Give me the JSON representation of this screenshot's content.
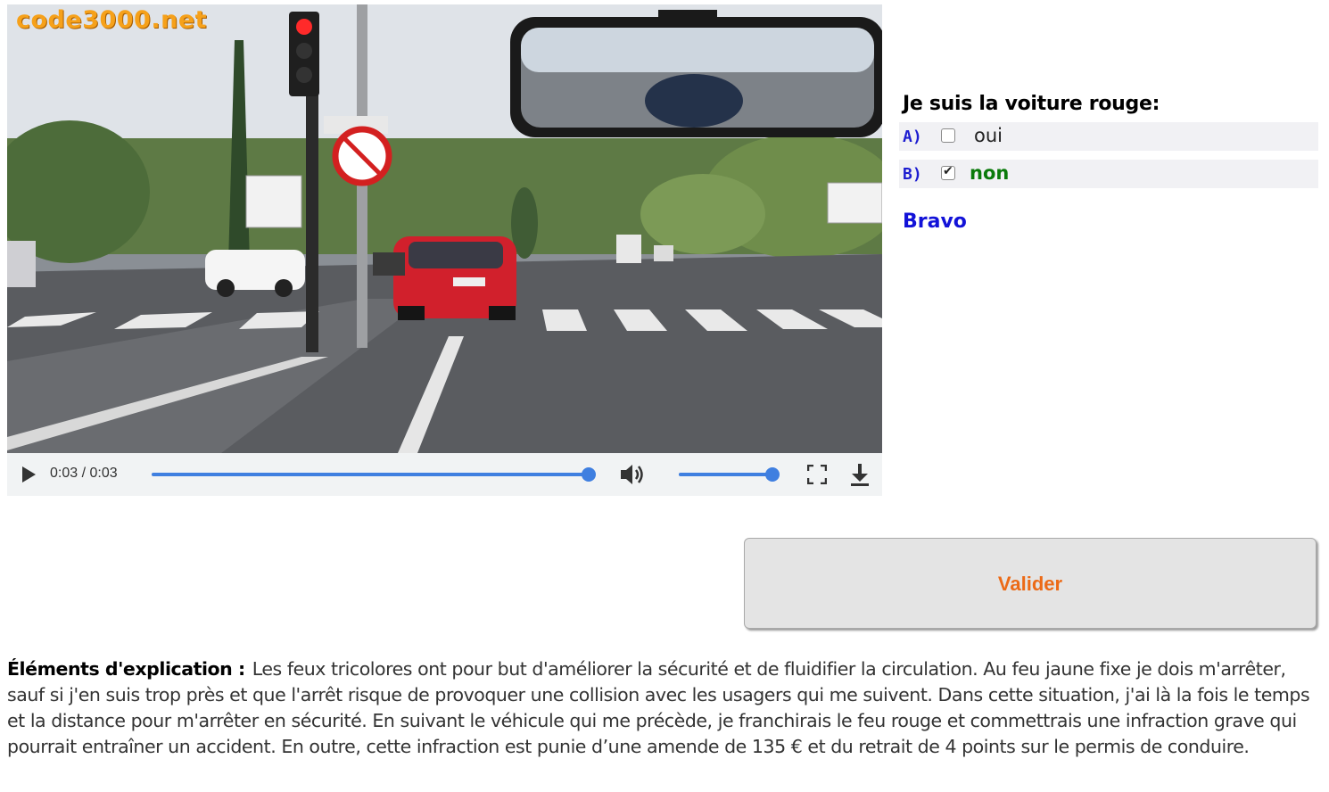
{
  "video": {
    "watermark": "code3000.net",
    "current_time": "0:03",
    "duration": "0:03",
    "time_separator": " / ",
    "progress": 1.0,
    "volume": 1.0
  },
  "question": {
    "prompt": "Je suis la voiture rouge:",
    "answers": [
      {
        "letter": "A)",
        "text": "oui",
        "checked": false
      },
      {
        "letter": "B)",
        "text": "non",
        "checked": true,
        "correct": true
      }
    ],
    "feedback": "Bravo"
  },
  "validate_label": "Valider",
  "explanation": {
    "label": "Éléments d'explication :",
    "text": "Les feux tricolores ont pour but d'améliorer la sécurité et de fluidifier la circulation. Au feu jaune fixe je dois m'arrêter, sauf si j'en suis trop près et que l'arrêt risque de provoquer une collision avec les usagers qui me suivent. Dans cette situation, j'ai là la fois le temps et la distance pour m'arrêter en sécurité. En suivant le véhicule qui me précède, je franchirais le feu rouge et commettrais une infraction grave qui pourrait entraîner un accident. En outre, cette infraction est punie d’une amende de 135 € et du retrait de 4 points sur le permis de conduire."
  },
  "colors": {
    "watermark": "#f6a11a",
    "answer_letter": "#1c1cd0",
    "correct_answer": "#0a7a0a",
    "feedback": "#1212d8",
    "validate_text": "#ec6a16",
    "media_accent": "#3f7fe0"
  },
  "icons": [
    "play-icon",
    "volume-icon",
    "fullscreen-icon",
    "download-icon"
  ]
}
